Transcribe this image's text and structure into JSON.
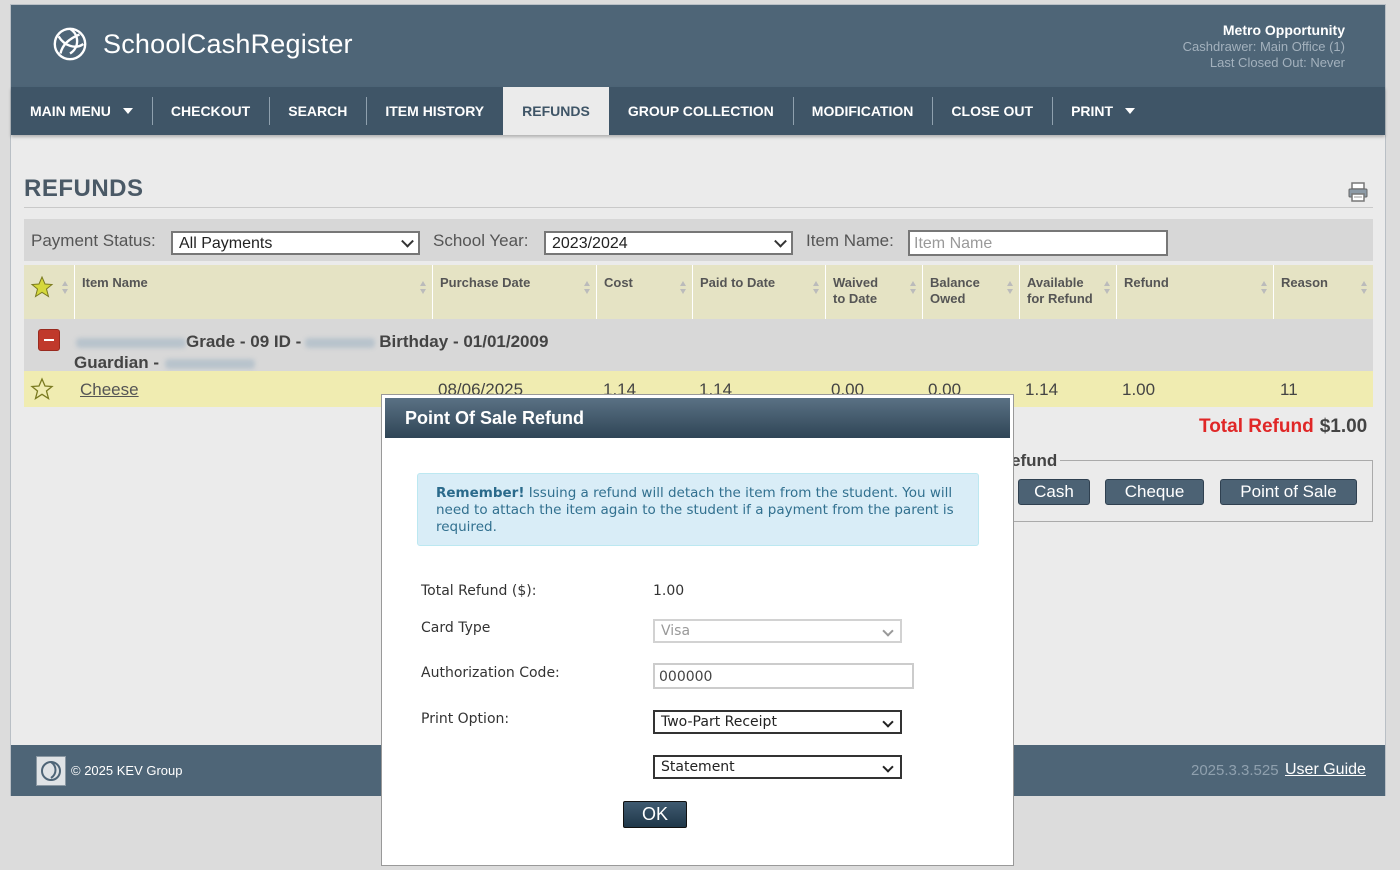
{
  "app": {
    "name": "SchoolCashRegister",
    "org_name": "Metro Opportunity",
    "cashdrawer": "Cashdrawer: Main Office (1)",
    "last_closed": "Last Closed Out: Never"
  },
  "nav": {
    "items": [
      {
        "label": "MAIN MENU",
        "dropdown": true
      },
      {
        "label": "CHECKOUT"
      },
      {
        "label": "SEARCH"
      },
      {
        "label": "ITEM HISTORY"
      },
      {
        "label": "REFUNDS",
        "active": true
      },
      {
        "label": "GROUP COLLECTION"
      },
      {
        "label": "MODIFICATION"
      },
      {
        "label": "CLOSE OUT"
      },
      {
        "label": "PRINT",
        "dropdown": true
      }
    ]
  },
  "page": {
    "title": "REFUNDS"
  },
  "filters": {
    "payment_status_label": "Payment Status:",
    "payment_status_value": "All Payments",
    "school_year_label": "School Year:",
    "school_year_value": "2023/2024",
    "item_name_label": "Item Name:",
    "item_name_placeholder": "Item Name"
  },
  "table": {
    "columns": [
      "Item Name",
      "Purchase Date",
      "Cost",
      "Paid to Date",
      "Waived to Date",
      "Balance Owed",
      "Available for Refund",
      "Refund",
      "Reason"
    ],
    "group": {
      "grade_text": "Grade - 09 ID -",
      "birthday_text": "Birthday - 01/01/2009",
      "guardian_text": "Guardian -"
    },
    "rows": [
      {
        "item_name": "Cheese",
        "purchase_date": "08/06/2025",
        "cost": "1.14",
        "paid_to_date": "1.14",
        "waived_to_date": "0.00",
        "balance_owed": "0.00",
        "available_for_refund": "1.14",
        "refund": "1.00",
        "reason": "11"
      }
    ]
  },
  "totals": {
    "total_refund_label": "Total Refund",
    "total_refund_value": "$1.00"
  },
  "refund_panel": {
    "legend": "efund",
    "buttons": [
      "Cash",
      "Cheque",
      "Point of Sale"
    ]
  },
  "footer": {
    "copyright": "© 2025 KEV Group",
    "version": "2025.3.3.525",
    "user_guide": "User Guide"
  },
  "modal": {
    "title": "Point Of Sale Refund",
    "alert_strong": "Remember!",
    "alert_text": "Issuing a refund will detach the item from the student. You will need to attach the item again to the student if a payment from the parent is required.",
    "total_refund_label": "Total Refund ($):",
    "total_refund_value": "1.00",
    "card_type_label": "Card Type",
    "card_type_value": "Visa",
    "auth_code_label": "Authorization Code:",
    "auth_code_value": "000000",
    "print_option_label": "Print Option:",
    "print_option_value": "Two-Part Receipt",
    "print_option2_value": "Statement",
    "ok_label": "OK"
  },
  "colors": {
    "header": "#4e6577",
    "nav": "#3f5567",
    "accent_red": "#e02727",
    "row_highlight": "#f0ecb1"
  }
}
